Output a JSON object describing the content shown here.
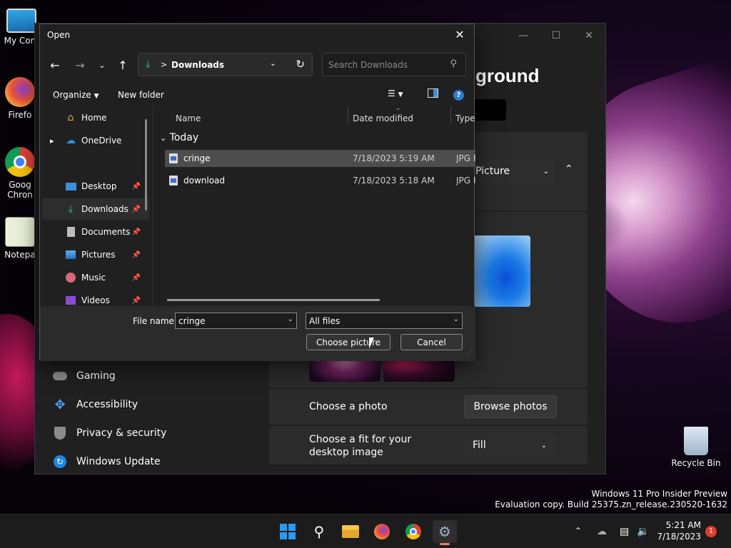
{
  "desktop": {
    "icons": [
      {
        "label": "My Com"
      },
      {
        "label": "Firefo"
      },
      {
        "label": "Goog\nChron"
      },
      {
        "label": "Notepa"
      },
      {
        "label": "Recycle Bin"
      }
    ],
    "watermark_line1": "Windows 11 Pro Insider Preview",
    "watermark_line2": "Evaluation copy. Build 25375.zn_release.230520-1632"
  },
  "settings": {
    "heading": "ground",
    "window_buttons": [
      "—",
      "☐",
      "✕"
    ],
    "picture_dropdown": "Picture",
    "nav": [
      {
        "label": "Gaming",
        "icon": "gamepad-icon"
      },
      {
        "label": "Accessibility",
        "icon": "accessibility-icon"
      },
      {
        "label": "Privacy & security",
        "icon": "shield-icon"
      },
      {
        "label": "Windows Update",
        "icon": "update-icon"
      }
    ],
    "choose_photo_label": "Choose a photo",
    "browse_photos_button": "Browse photos",
    "choose_fit_label": "Choose a fit for your desktop image",
    "fit_value": "Fill"
  },
  "dialog": {
    "title": "Open",
    "address": {
      "path": "Downloads",
      "separator": ">"
    },
    "search_placeholder": "Search Downloads",
    "toolbar": {
      "organize": "Organize",
      "new_folder": "New folder"
    },
    "sidebar": [
      {
        "label": "Home",
        "pinned": false
      },
      {
        "label": "OneDrive",
        "pinned": false
      },
      {
        "label": "Desktop",
        "pinned": true
      },
      {
        "label": "Downloads",
        "pinned": true
      },
      {
        "label": "Documents",
        "pinned": true
      },
      {
        "label": "Pictures",
        "pinned": true
      },
      {
        "label": "Music",
        "pinned": true
      },
      {
        "label": "Videos",
        "pinned": true
      }
    ],
    "columns": {
      "name": "Name",
      "date": "Date modified",
      "type": "Type"
    },
    "group_label": "Today",
    "files": [
      {
        "name": "cringe",
        "date": "7/18/2023 5:19 AM",
        "type": "JPG F",
        "selected": true
      },
      {
        "name": "download",
        "date": "7/18/2023 5:18 AM",
        "type": "JPG F",
        "selected": false
      }
    ],
    "filename_label": "File name:",
    "filename_value": "cringe",
    "filetype_value": "All files",
    "choose_button": "Choose picture",
    "cancel_button": "Cancel"
  },
  "taskbar": {
    "apps": [
      "start-icon",
      "search-icon",
      "file-explorer-icon",
      "firefox-icon",
      "chrome-icon",
      "settings-icon"
    ],
    "time": "5:21 AM",
    "date": "7/18/2023",
    "notification_count": "1"
  }
}
